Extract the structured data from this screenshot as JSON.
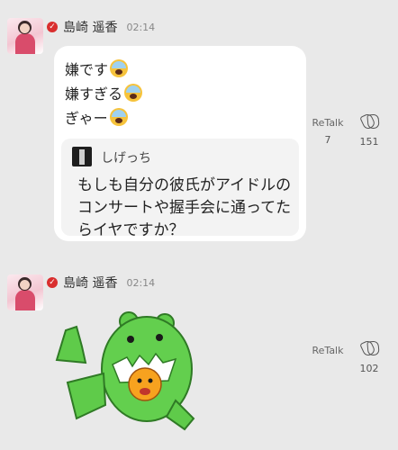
{
  "posts": [
    {
      "author": "島崎 遥香",
      "time": "02:14",
      "messages": [
        "嫌です",
        "嫌すぎる",
        "ぎゃー"
      ],
      "emoji_icon": "scream-emoji",
      "quote": {
        "author": "しげっち",
        "text": "もしも自分の彼氏がアイドルのコンサートや握手会に通ってたらイヤですか？"
      },
      "retalk_label": "ReTalk",
      "retalk_count": "7",
      "clap_count": "151"
    },
    {
      "author": "島崎 遥香",
      "time": "02:14",
      "sticker": "green-bear-sticker",
      "retalk_label": "ReTalk",
      "clap_count": "102"
    }
  ],
  "colors": {
    "background": "#e9e9e9",
    "bubble": "#ffffff",
    "verified": "#d92e2e",
    "sticker_green": "#5fcb4a"
  }
}
